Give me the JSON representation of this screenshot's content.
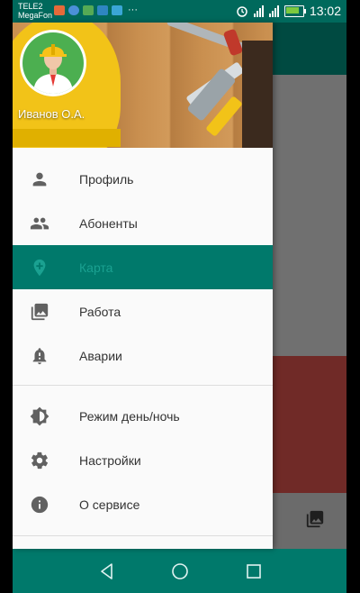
{
  "status_bar": {
    "carrier_line1": "TELE2",
    "carrier_line2": "MegaFon",
    "more_dots": "···",
    "time": "13:02"
  },
  "drawer": {
    "user_name": "Иванов О.А.",
    "menu_group1": [
      {
        "label": "Профиль",
        "icon": "person-icon"
      },
      {
        "label": "Абоненты",
        "icon": "people-icon"
      },
      {
        "label": "Карта",
        "icon": "map-pin-icon",
        "active": true
      },
      {
        "label": "Работа",
        "icon": "photo-library-icon"
      },
      {
        "label": "Аварии",
        "icon": "alert-bell-icon"
      }
    ],
    "menu_group2": [
      {
        "label": "Режим день/ночь",
        "icon": "brightness-icon"
      },
      {
        "label": "Настройки",
        "icon": "gear-icon"
      },
      {
        "label": "О сервисе",
        "icon": "info-icon"
      }
    ]
  },
  "colors": {
    "primary": "#00796b",
    "primary_dark": "#00695c",
    "active_text": "#1aa191",
    "icon_gray": "#616161"
  }
}
